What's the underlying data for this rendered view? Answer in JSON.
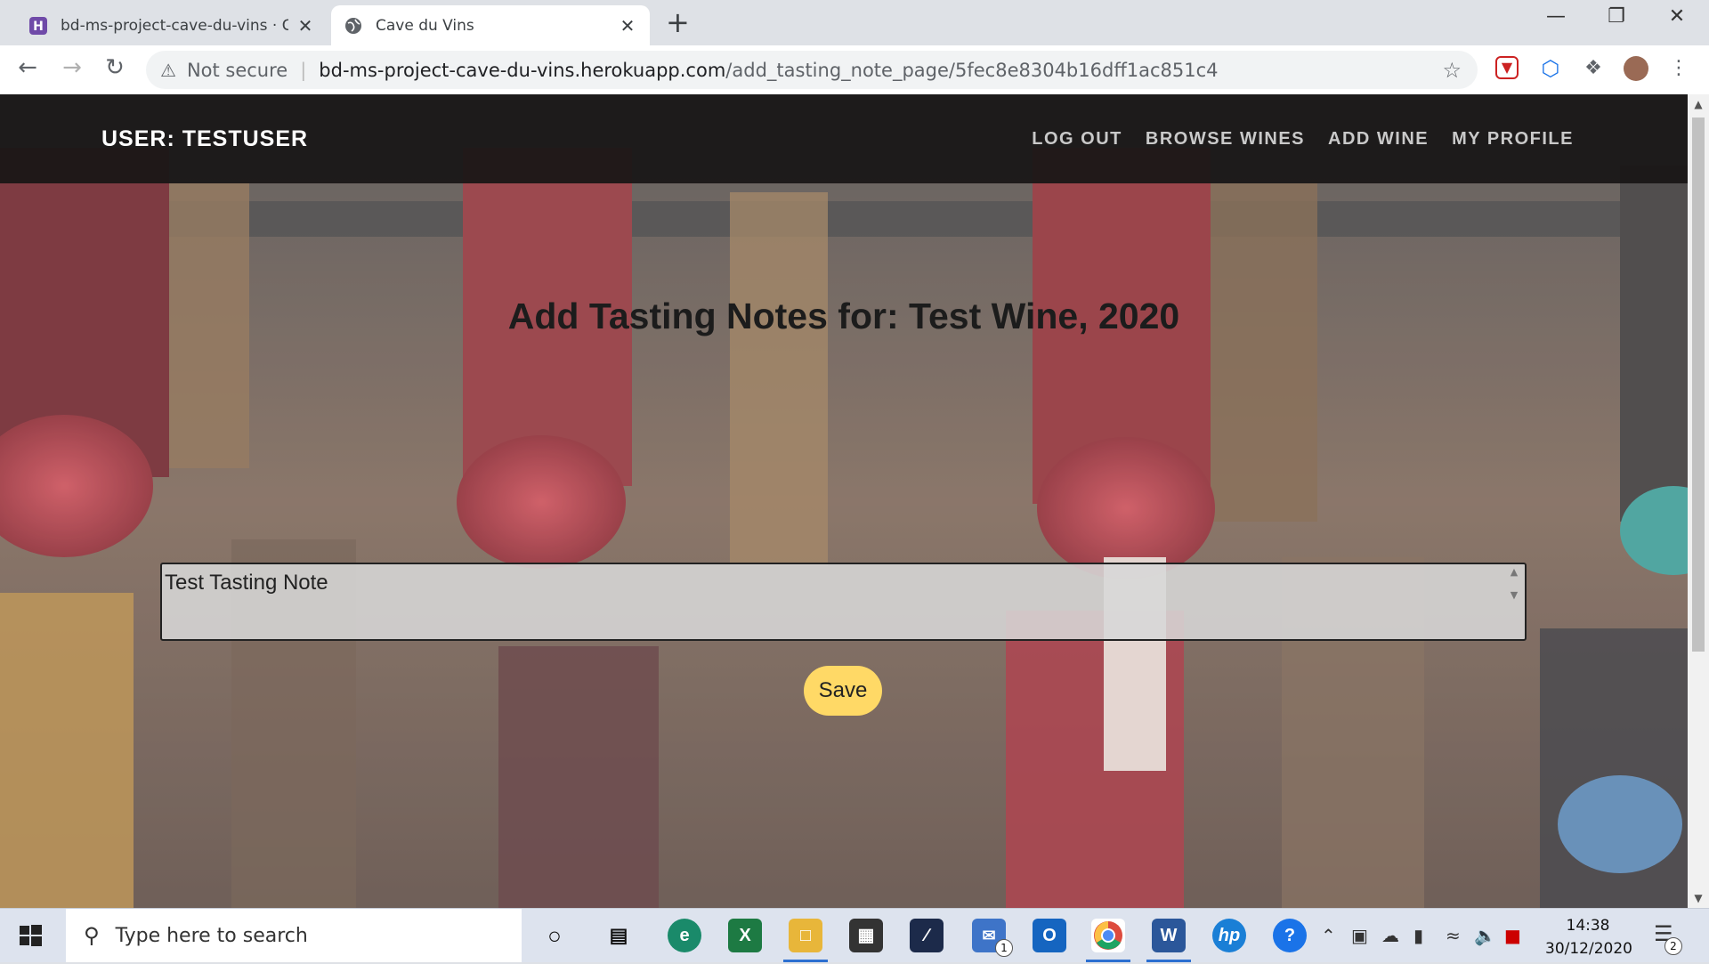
{
  "browser": {
    "tabs": [
      {
        "title": "bd-ms-project-cave-du-vins · Git",
        "close": "✕"
      },
      {
        "title": "Cave du Vins",
        "close": "✕"
      }
    ],
    "new_tab": "+",
    "security_label": "Not secure",
    "url_host": "bd-ms-project-cave-du-vins.herokuapp.com",
    "url_path": "/add_tasting_note_page/5fec8e8304b16dff1ac851c4"
  },
  "navbar": {
    "brand": "USER: TESTUSER",
    "links": [
      "LOG OUT",
      "BROWSE WINES",
      "ADD WINE",
      "MY PROFILE"
    ]
  },
  "main": {
    "heading": "Add Tasting Notes for: Test Wine, 2020",
    "note_value": "Test Tasting Note",
    "save_label": "Save"
  },
  "taskbar": {
    "search_placeholder": "Type here to search",
    "time": "14:38",
    "date": "30/12/2020",
    "mail_badge": "1",
    "notification_badge": "2"
  },
  "colors": {
    "navbar_bg": "#181616",
    "save_button": "#ffd966",
    "heading_text": "#1c1c1c"
  }
}
